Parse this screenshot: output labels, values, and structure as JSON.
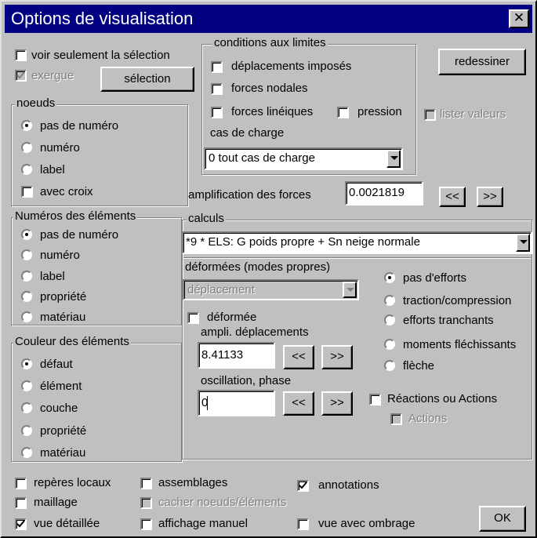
{
  "window": {
    "title": "Options de visualisation",
    "close_glyph": "✕"
  },
  "top": {
    "voir_selection": "voir seulement la sélection",
    "exergue": "exergue",
    "selection_button": "sélection",
    "redessiner_button": "redessiner",
    "lister_valeurs": "lister valeurs"
  },
  "conditions": {
    "legend": "conditions aux limites",
    "deplacements": "déplacements imposés",
    "forces_nodales": "forces nodales",
    "forces_lineiques": "forces linéiques",
    "pression": "pression",
    "cas_label": "cas de charge",
    "cas_value": "0 tout cas de charge"
  },
  "amplification": {
    "label": "amplification des forces",
    "value": "0.0021819",
    "dec": "<<",
    "inc": ">>"
  },
  "noeuds": {
    "legend": "noeuds",
    "options": [
      "pas de numéro",
      "numéro",
      "label"
    ],
    "avec_croix": "avec croix"
  },
  "numeros": {
    "legend": "Numéros des éléments",
    "options": [
      "pas de numéro",
      "numéro",
      "label",
      "propriété",
      "matériau"
    ]
  },
  "couleur": {
    "legend": "Couleur des éléments",
    "options": [
      "défaut",
      "élément",
      "couche",
      "propriété",
      "matériau"
    ]
  },
  "calculs": {
    "legend": "calculs",
    "combo_value": "*9 * ELS: G poids propre + Sn neige normale",
    "deformees_label": "déformées (modes propres)",
    "deformees_value": "déplacement",
    "deformee": "déformée",
    "ampli_label": "ampli. déplacements",
    "ampli_value": "8.41133",
    "oscillation_label": "oscillation, phase",
    "oscillation_value": "0",
    "dec": "<<",
    "inc": ">>",
    "efforts": [
      "pas d'efforts",
      "traction/compression",
      "efforts tranchants",
      "moments fléchissants",
      "flèche"
    ],
    "reactions": "Réactions ou Actions",
    "actions": "Actions"
  },
  "bottom": {
    "reperes": "repères locaux",
    "assemblages": "assemblages",
    "annotations": "annotations",
    "maillage": "maillage",
    "cacher": "cacher noeuds/éléments",
    "vue_detaillee": "vue détaillée",
    "affichage_manuel": "affichage manuel",
    "vue_ombrage": "vue avec ombrage",
    "ok": "OK"
  }
}
